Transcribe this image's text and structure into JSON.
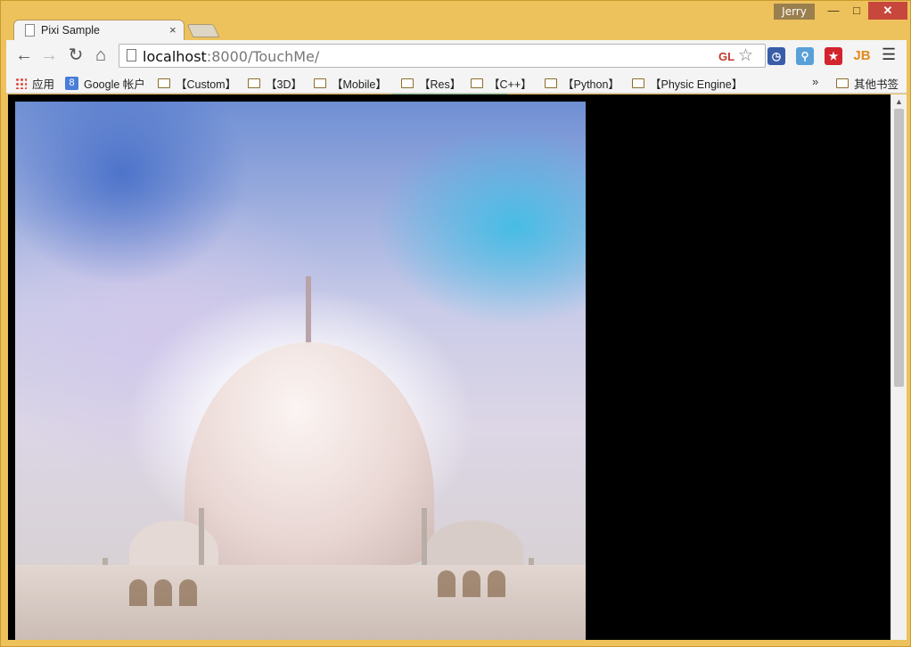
{
  "window": {
    "user": "Jerry"
  },
  "tab": {
    "title": "Pixi Sample",
    "close": "×"
  },
  "toolbar": {
    "url_host": "localhost",
    "url_rest": ":8000/TouchMe/",
    "gl_badge": "GL"
  },
  "extensions": {
    "jb": "JB"
  },
  "bookmarks": {
    "items": [
      {
        "label": "应用"
      },
      {
        "label": "Google 帐户"
      },
      {
        "label": "【Custom】"
      },
      {
        "label": "【3D】"
      },
      {
        "label": "【Mobile】"
      },
      {
        "label": "【Res】"
      },
      {
        "label": "【C++】"
      },
      {
        "label": "【Python】"
      },
      {
        "label": "【Physic Engine】"
      },
      {
        "label": "其他书签"
      }
    ],
    "more": "»"
  },
  "icons": {
    "back": "arrow-left-icon",
    "forward": "arrow-right-icon",
    "reload": "reload-icon",
    "home": "home-icon",
    "star": "star-icon",
    "menu": "hamburger-menu-icon"
  }
}
